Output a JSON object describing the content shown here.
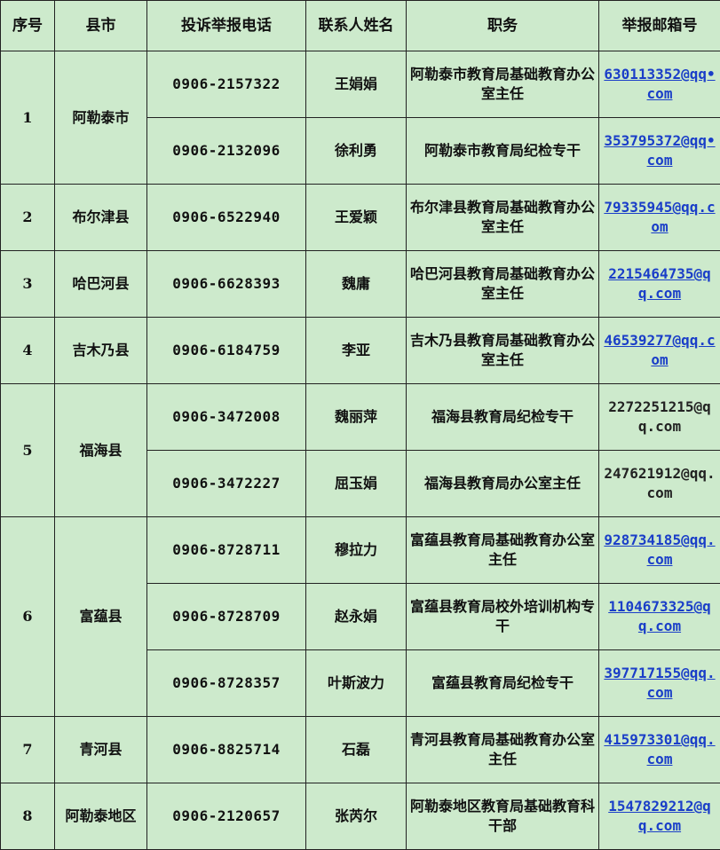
{
  "headers": {
    "index": "序号",
    "county": "县市",
    "phone": "投诉举报电话",
    "contact": "联系人姓名",
    "duty": "职务",
    "email": "举报邮箱号"
  },
  "groups": [
    {
      "index": "1",
      "county": "阿勒泰市"
    },
    {
      "index": "2",
      "county": "布尔津县"
    },
    {
      "index": "3",
      "county": "哈巴河县"
    },
    {
      "index": "4",
      "county": "吉木乃县"
    },
    {
      "index": "5",
      "county": "福海县"
    },
    {
      "index": "6",
      "county": "富蕴县"
    },
    {
      "index": "7",
      "county": "青河县"
    },
    {
      "index": "8",
      "county": "阿勒泰地区"
    }
  ],
  "rows": [
    {
      "phone": "0906-2157322",
      "contact": "王娟娟",
      "duty": "阿勒泰市教育局基础教育办公室主任",
      "email": "630113352@qq•com"
    },
    {
      "phone": "0906-2132096",
      "contact": "徐利勇",
      "duty": "阿勒泰市教育局纪检专干",
      "email": "353795372@qq•com"
    },
    {
      "phone": "0906-6522940",
      "contact": "王爱颖",
      "duty": "布尔津县教育局基础教育办公室主任",
      "email": "79335945@qq.com"
    },
    {
      "phone": "0906-6628393",
      "contact": "魏庸",
      "duty": "哈巴河县教育局基础教育办公室主任",
      "email": "2215464735@qq.com"
    },
    {
      "phone": "0906-6184759",
      "contact": "李亚",
      "duty": "吉木乃县教育局基础教育办公室主任",
      "email": "46539277@qq.com"
    },
    {
      "phone": "0906-3472008",
      "contact": "魏丽萍",
      "duty": "福海县教育局纪检专干",
      "email": "2272251215@qq.com"
    },
    {
      "phone": "0906-3472227",
      "contact": "屈玉娟",
      "duty": "福海县教育局办公室主任",
      "email": "247621912@qq.com"
    },
    {
      "phone": "0906-8728711",
      "contact": "穆拉力",
      "duty": "富蕴县教育局基础教育办公室主任",
      "email": "928734185@qq.com"
    },
    {
      "phone": "0906-8728709",
      "contact": "赵永娟",
      "duty": "富蕴县教育局校外培训机构专干",
      "email": "1104673325@qq.com"
    },
    {
      "phone": "0906-8728357",
      "contact": "叶斯波力",
      "duty": "富蕴县教育局纪检专干",
      "email": "397717155@qq.com"
    },
    {
      "phone": "0906-8825714",
      "contact": "石磊",
      "duty": "青河县教育局基础教育办公室主任",
      "email": "415973301@qq.com"
    },
    {
      "phone": "0906-2120657",
      "contact": "张芮尔",
      "duty": "阿勒泰地区教育局基础教育科干部",
      "email": "1547829212@qq.com"
    }
  ],
  "colors": {
    "background": "#cdeacc",
    "border": "#222222",
    "link": "#1a3ec8"
  }
}
